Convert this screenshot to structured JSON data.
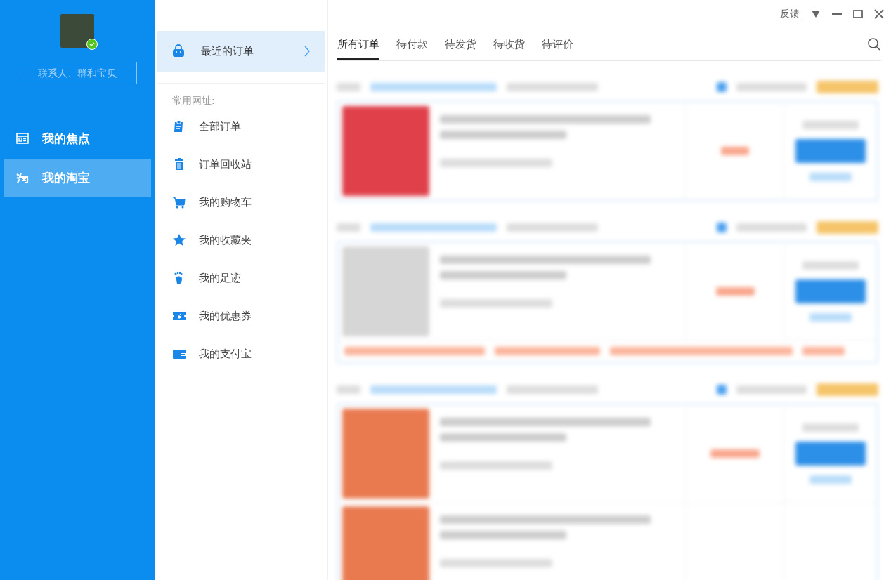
{
  "profile": {
    "online": true
  },
  "search": {
    "placeholder": "联系人、群和宝贝"
  },
  "nav": [
    {
      "kind": "focus",
      "label": "我的焦点",
      "selected": false
    },
    {
      "kind": "taobao",
      "label": "我的淘宝",
      "selected": true
    }
  ],
  "recent": {
    "label": "最近的订单",
    "selected": true
  },
  "links_title": "常用网址:",
  "links": [
    {
      "kind": "orders",
      "label": "全部订单"
    },
    {
      "kind": "trash",
      "label": "订单回收站"
    },
    {
      "kind": "cart",
      "label": "我的购物车"
    },
    {
      "kind": "star",
      "label": "我的收藏夹"
    },
    {
      "kind": "foot",
      "label": "我的足迹"
    },
    {
      "kind": "coupon",
      "label": "我的优惠券"
    },
    {
      "kind": "wallet",
      "label": "我的支付宝"
    }
  ],
  "title_bar": {
    "feedback": "反馈"
  },
  "tabs": [
    {
      "label": "所有订单",
      "selected": true
    },
    {
      "label": "待付款",
      "selected": false
    },
    {
      "label": "待发货",
      "selected": false
    },
    {
      "label": "待收货",
      "selected": false
    },
    {
      "label": "待评价",
      "selected": false
    }
  ],
  "blurred_orders": [
    {
      "has_notice": false,
      "two_products": false
    },
    {
      "has_notice": true,
      "two_products": false
    },
    {
      "has_notice": false,
      "two_products": true
    }
  ]
}
